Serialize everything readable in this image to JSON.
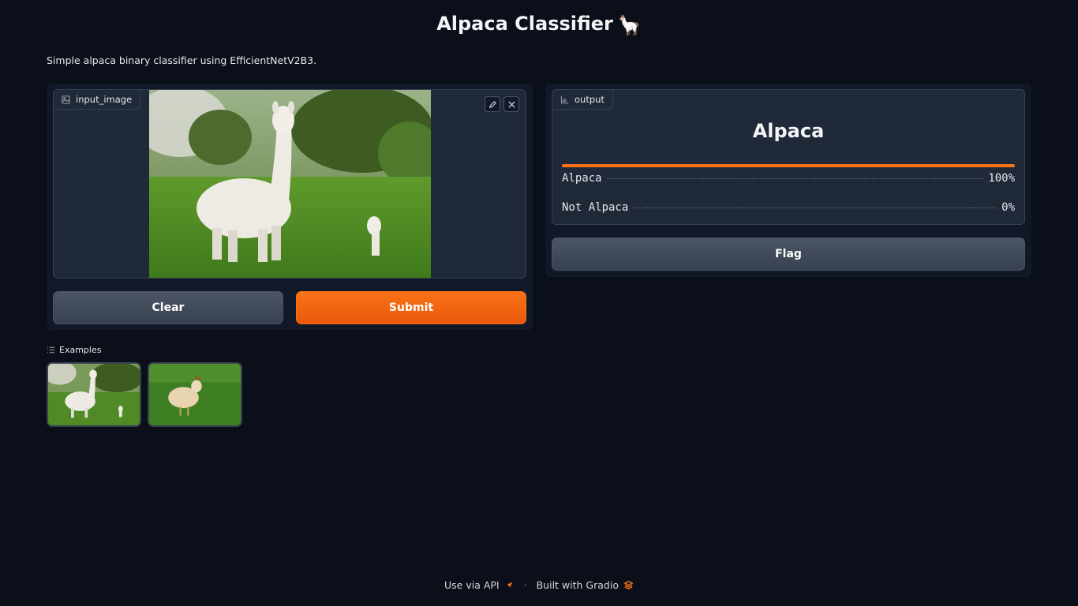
{
  "header": {
    "title": "Alpaca Classifier",
    "title_emoji": "🦙",
    "description": "Simple alpaca binary classifier using EfficientNetV2B3."
  },
  "input": {
    "label": "input_image",
    "label_icon": "image-icon",
    "edit_icon": "pencil-icon",
    "clear_icon": "close-icon",
    "image_subject": "alpaca"
  },
  "buttons": {
    "clear": "Clear",
    "submit": "Submit",
    "flag": "Flag"
  },
  "output": {
    "label": "output",
    "label_icon": "bar-chart-icon",
    "predicted": "Alpaca",
    "confidences": [
      {
        "label": "Alpaca",
        "value_text": "100%",
        "value": 1.0
      },
      {
        "label": "Not Alpaca",
        "value_text": "0%",
        "value": 0.0
      }
    ]
  },
  "examples": {
    "label": "Examples",
    "items": [
      {
        "subject": "alpaca"
      },
      {
        "subject": "chicken"
      }
    ]
  },
  "footer": {
    "api_text": "Use via API",
    "separator": "·",
    "built_text": "Built with Gradio"
  },
  "colors": {
    "background": "#0b0f19",
    "panel": "#111827",
    "block": "#1f2937",
    "accent": "#f97316",
    "secondary_button": "#4b5563"
  }
}
